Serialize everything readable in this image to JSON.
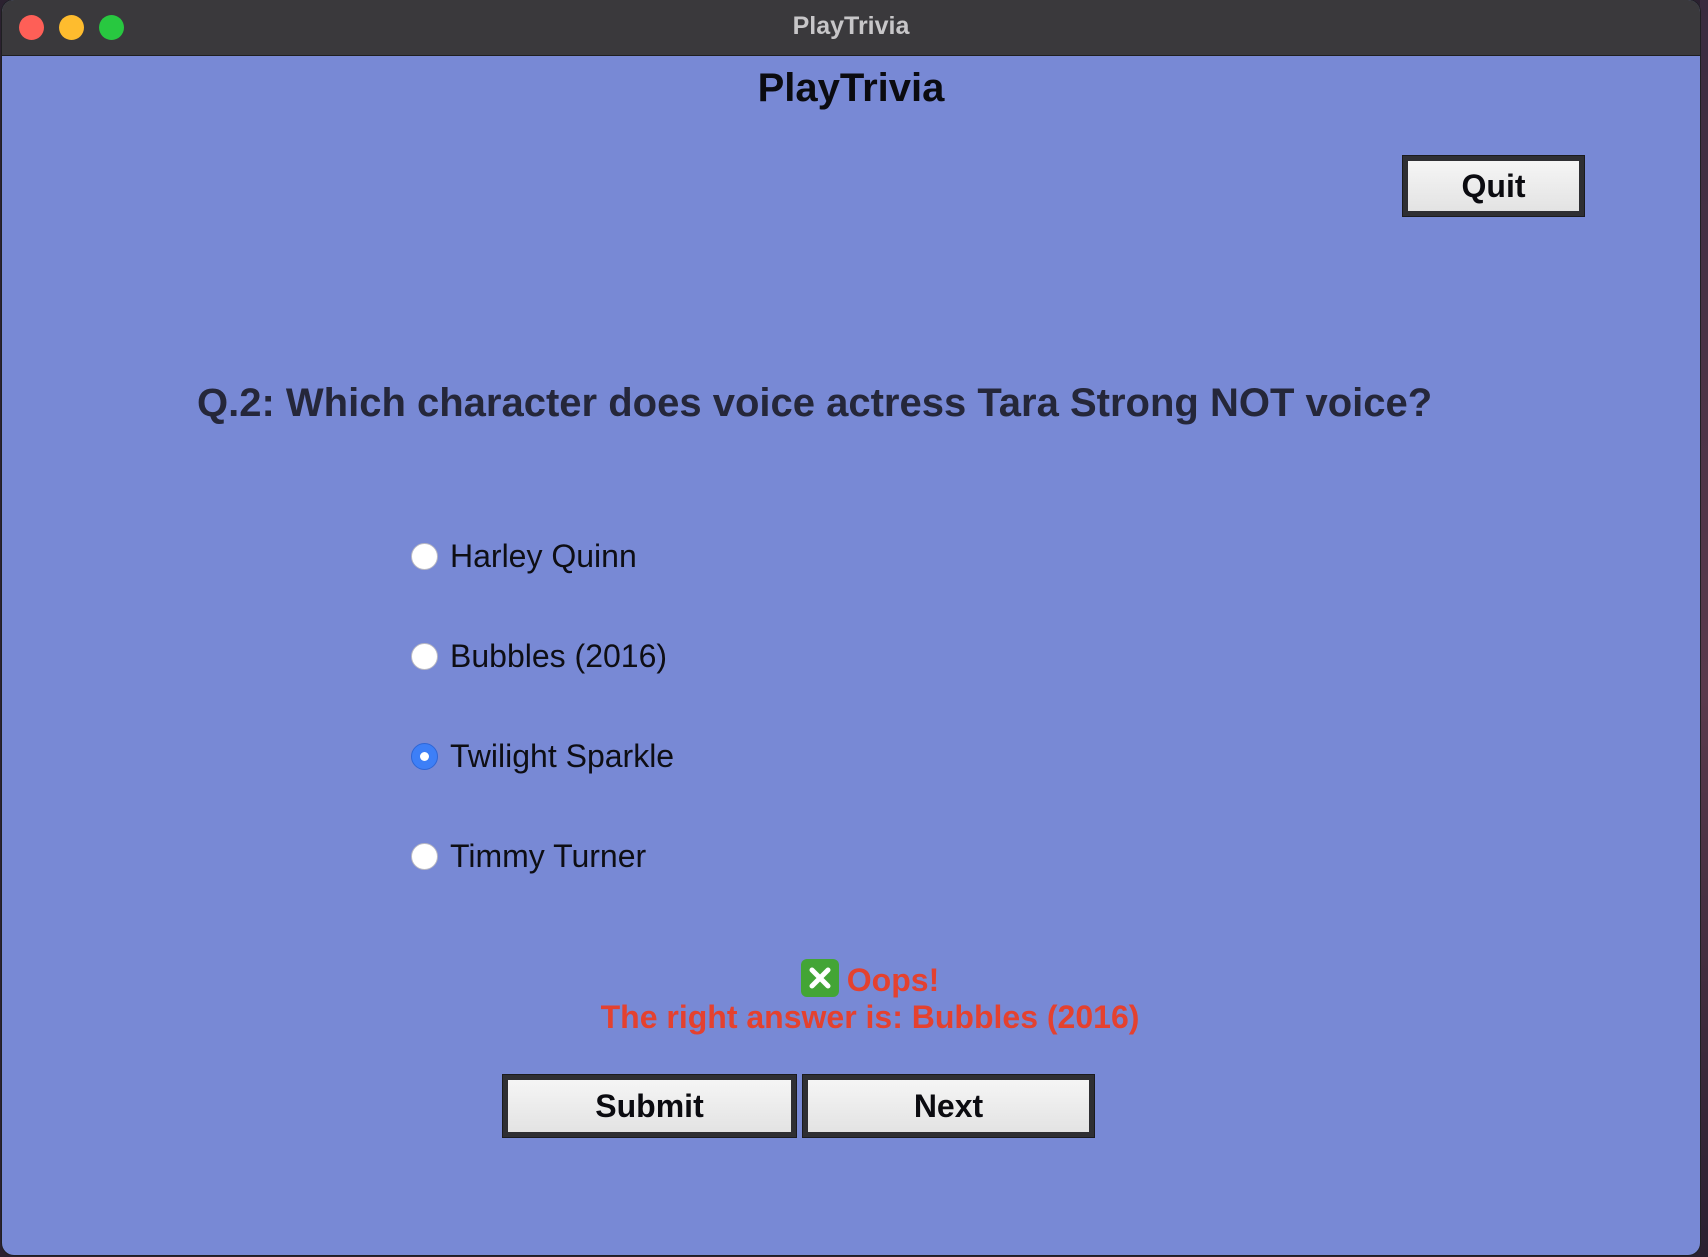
{
  "window": {
    "title": "PlayTrivia"
  },
  "app": {
    "heading": "PlayTrivia",
    "quit_label": "Quit"
  },
  "question": {
    "text": "Q.2: Which character does voice actress Tara Strong NOT voice?",
    "options": [
      {
        "label": "Harley Quinn",
        "selected": false
      },
      {
        "label": "Bubbles (2016)",
        "selected": false
      },
      {
        "label": "Twilight Sparkle",
        "selected": true
      },
      {
        "label": "Timmy Turner",
        "selected": false
      }
    ]
  },
  "feedback": {
    "icon": "cross-mark-icon",
    "headline": "Oops!",
    "detail": "The right answer is: Bubbles (2016)",
    "color": "#e4412f"
  },
  "actions": {
    "submit_label": "Submit",
    "next_label": "Next"
  },
  "colors": {
    "background": "#7889d5",
    "radio_selected": "#3d7ff7"
  }
}
